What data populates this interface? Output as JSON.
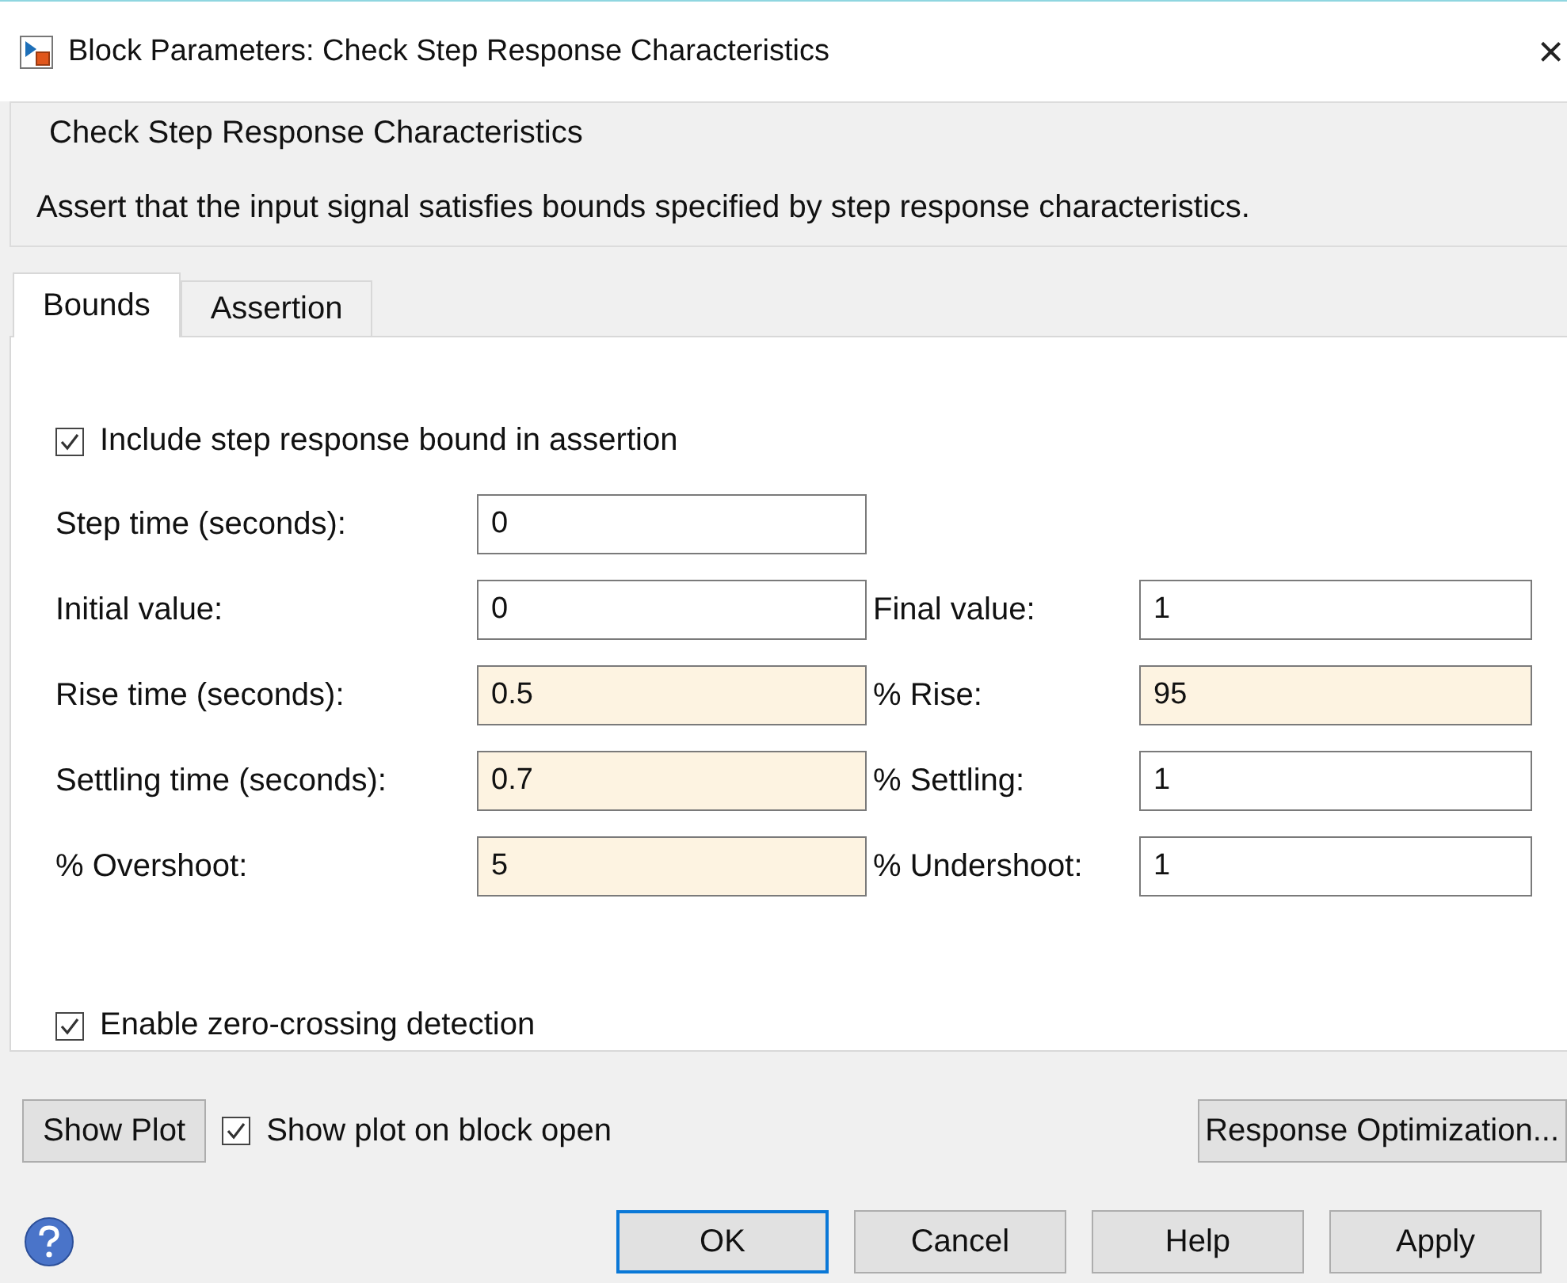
{
  "window": {
    "title": "Block Parameters: Check Step Response  Characteristics",
    "close": "×"
  },
  "group": {
    "title": "Check Step Response Characteristics",
    "description": "Assert that the input signal satisfies bounds specified by step response characteristics."
  },
  "tabs": [
    {
      "label": "Bounds",
      "selected": true
    },
    {
      "label": "Assertion",
      "selected": false
    }
  ],
  "include_bound": {
    "label": "Include step response bound in assertion",
    "checked": true
  },
  "rows": [
    {
      "left": {
        "label": "Step time (seconds):",
        "value": "0",
        "highlighted": false
      }
    },
    {
      "left": {
        "label": "Initial value:",
        "value": "0",
        "highlighted": false
      },
      "right": {
        "label": "Final value:",
        "value": "1",
        "highlighted": false
      }
    },
    {
      "left": {
        "label": "Rise time (seconds):",
        "value": "0.5",
        "highlighted": true
      },
      "right": {
        "label": "% Rise:",
        "value": "95",
        "highlighted": true
      }
    },
    {
      "left": {
        "label": "Settling time (seconds):",
        "value": "0.7",
        "highlighted": true
      },
      "right": {
        "label": "% Settling:",
        "value": "1",
        "highlighted": false
      }
    },
    {
      "left": {
        "label": "% Overshoot:",
        "value": "5",
        "highlighted": true
      },
      "right": {
        "label": "% Undershoot:",
        "value": "1",
        "highlighted": false
      }
    }
  ],
  "zero_crossing": {
    "label": "Enable zero-crossing detection",
    "checked": true
  },
  "show_plot_button": "Show Plot",
  "show_plot_on_open": {
    "label": "Show plot on block open",
    "checked": true
  },
  "response_optimization_button": "Response Optimization...",
  "buttons": [
    {
      "label": "OK",
      "selected": true
    },
    {
      "label": "Cancel",
      "selected": false
    },
    {
      "label": "Help",
      "selected": false
    },
    {
      "label": "Apply",
      "selected": false
    }
  ]
}
